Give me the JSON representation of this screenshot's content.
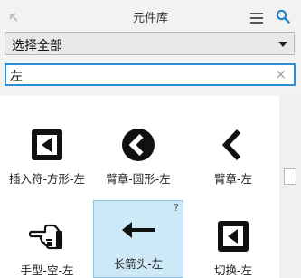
{
  "header": {
    "title": "元件库"
  },
  "library_select": {
    "value": "选择全部"
  },
  "search": {
    "value": "左",
    "clear_glyph": "×"
  },
  "items": [
    {
      "label": "插入符-方形-左",
      "icon": "caret-square-left-icon",
      "selected": false
    },
    {
      "label": "臂章-圆形-左",
      "icon": "chevron-circle-left-icon",
      "selected": false
    },
    {
      "label": "臂章-左",
      "icon": "chevron-left-icon",
      "selected": false
    },
    {
      "label": "手型-空-左",
      "icon": "hand-point-left-icon",
      "selected": false
    },
    {
      "label": "长箭头-左",
      "icon": "long-arrow-left-icon",
      "selected": true,
      "help": "?"
    },
    {
      "label": "切换-左",
      "icon": "toggle-left-icon",
      "selected": false
    }
  ],
  "colors": {
    "accent": "#2a8fd6",
    "selected_bg": "#cde8f6"
  }
}
